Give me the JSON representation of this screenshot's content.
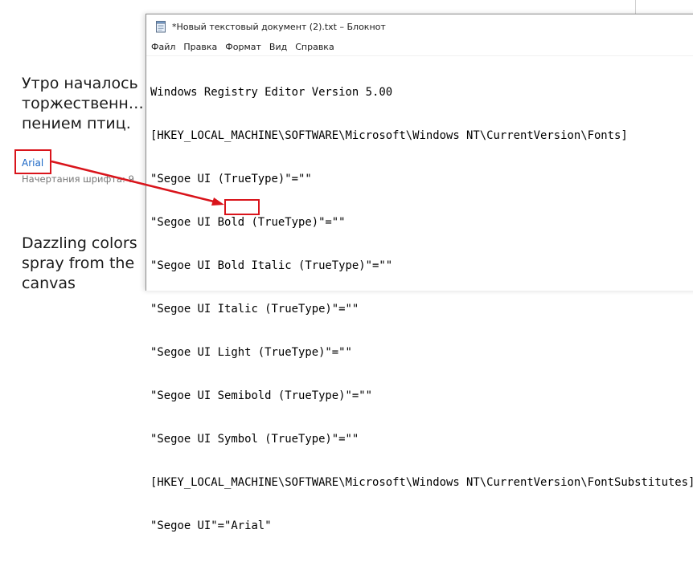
{
  "settings": {
    "preview_ru": "Утро началось\nторжественн…\nпением птиц.",
    "font_name": "Arial",
    "font_styles_label": "Начертания шрифта: 9",
    "preview_en": "Dazzling colors\nspray from the\ncanvas"
  },
  "notepad": {
    "title": "*Новый текстовый документ (2).txt – Блокнот",
    "menu": [
      "Файл",
      "Правка",
      "Формат",
      "Вид",
      "Справка"
    ],
    "lines": [
      "Windows Registry Editor Version 5.00",
      "[HKEY_LOCAL_MACHINE\\SOFTWARE\\Microsoft\\Windows NT\\CurrentVersion\\Fonts]",
      "\"Segoe UI (TrueType)\"=\"\"",
      "\"Segoe UI Bold (TrueType)\"=\"\"",
      "\"Segoe UI Bold Italic (TrueType)\"=\"\"",
      "\"Segoe UI Italic (TrueType)\"=\"\"",
      "\"Segoe UI Light (TrueType)\"=\"\"",
      "\"Segoe UI Semibold (TrueType)\"=\"\"",
      "\"Segoe UI Symbol (TrueType)\"=\"\"",
      "[HKEY_LOCAL_MACHINE\\SOFTWARE\\Microsoft\\Windows NT\\CurrentVersion\\FontSubstitutes]"
    ],
    "last_line_prefix": "\"Segoe UI\"=\"",
    "last_line_highlight": "Arial",
    "last_line_suffix": "\""
  },
  "colors": {
    "callout": "#d9141b",
    "link": "#1a66c5"
  }
}
